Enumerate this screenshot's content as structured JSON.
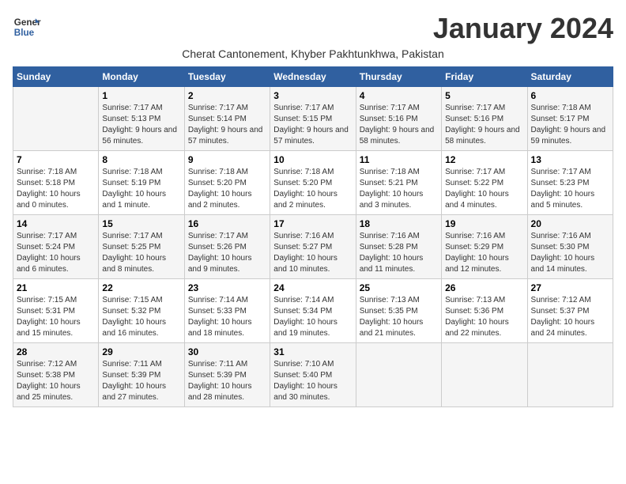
{
  "header": {
    "logo_line1": "General",
    "logo_line2": "Blue",
    "title": "January 2024",
    "subtitle": "Cherat Cantonement, Khyber Pakhtunkhwa, Pakistan"
  },
  "days_of_week": [
    "Sunday",
    "Monday",
    "Tuesday",
    "Wednesday",
    "Thursday",
    "Friday",
    "Saturday"
  ],
  "weeks": [
    [
      {
        "day": "",
        "sunrise": "",
        "sunset": "",
        "daylight": ""
      },
      {
        "day": "1",
        "sunrise": "Sunrise: 7:17 AM",
        "sunset": "Sunset: 5:13 PM",
        "daylight": "Daylight: 9 hours and 56 minutes."
      },
      {
        "day": "2",
        "sunrise": "Sunrise: 7:17 AM",
        "sunset": "Sunset: 5:14 PM",
        "daylight": "Daylight: 9 hours and 57 minutes."
      },
      {
        "day": "3",
        "sunrise": "Sunrise: 7:17 AM",
        "sunset": "Sunset: 5:15 PM",
        "daylight": "Daylight: 9 hours and 57 minutes."
      },
      {
        "day": "4",
        "sunrise": "Sunrise: 7:17 AM",
        "sunset": "Sunset: 5:16 PM",
        "daylight": "Daylight: 9 hours and 58 minutes."
      },
      {
        "day": "5",
        "sunrise": "Sunrise: 7:17 AM",
        "sunset": "Sunset: 5:16 PM",
        "daylight": "Daylight: 9 hours and 58 minutes."
      },
      {
        "day": "6",
        "sunrise": "Sunrise: 7:18 AM",
        "sunset": "Sunset: 5:17 PM",
        "daylight": "Daylight: 9 hours and 59 minutes."
      }
    ],
    [
      {
        "day": "7",
        "sunrise": "Sunrise: 7:18 AM",
        "sunset": "Sunset: 5:18 PM",
        "daylight": "Daylight: 10 hours and 0 minutes."
      },
      {
        "day": "8",
        "sunrise": "Sunrise: 7:18 AM",
        "sunset": "Sunset: 5:19 PM",
        "daylight": "Daylight: 10 hours and 1 minute."
      },
      {
        "day": "9",
        "sunrise": "Sunrise: 7:18 AM",
        "sunset": "Sunset: 5:20 PM",
        "daylight": "Daylight: 10 hours and 2 minutes."
      },
      {
        "day": "10",
        "sunrise": "Sunrise: 7:18 AM",
        "sunset": "Sunset: 5:20 PM",
        "daylight": "Daylight: 10 hours and 2 minutes."
      },
      {
        "day": "11",
        "sunrise": "Sunrise: 7:18 AM",
        "sunset": "Sunset: 5:21 PM",
        "daylight": "Daylight: 10 hours and 3 minutes."
      },
      {
        "day": "12",
        "sunrise": "Sunrise: 7:17 AM",
        "sunset": "Sunset: 5:22 PM",
        "daylight": "Daylight: 10 hours and 4 minutes."
      },
      {
        "day": "13",
        "sunrise": "Sunrise: 7:17 AM",
        "sunset": "Sunset: 5:23 PM",
        "daylight": "Daylight: 10 hours and 5 minutes."
      }
    ],
    [
      {
        "day": "14",
        "sunrise": "Sunrise: 7:17 AM",
        "sunset": "Sunset: 5:24 PM",
        "daylight": "Daylight: 10 hours and 6 minutes."
      },
      {
        "day": "15",
        "sunrise": "Sunrise: 7:17 AM",
        "sunset": "Sunset: 5:25 PM",
        "daylight": "Daylight: 10 hours and 8 minutes."
      },
      {
        "day": "16",
        "sunrise": "Sunrise: 7:17 AM",
        "sunset": "Sunset: 5:26 PM",
        "daylight": "Daylight: 10 hours and 9 minutes."
      },
      {
        "day": "17",
        "sunrise": "Sunrise: 7:16 AM",
        "sunset": "Sunset: 5:27 PM",
        "daylight": "Daylight: 10 hours and 10 minutes."
      },
      {
        "day": "18",
        "sunrise": "Sunrise: 7:16 AM",
        "sunset": "Sunset: 5:28 PM",
        "daylight": "Daylight: 10 hours and 11 minutes."
      },
      {
        "day": "19",
        "sunrise": "Sunrise: 7:16 AM",
        "sunset": "Sunset: 5:29 PM",
        "daylight": "Daylight: 10 hours and 12 minutes."
      },
      {
        "day": "20",
        "sunrise": "Sunrise: 7:16 AM",
        "sunset": "Sunset: 5:30 PM",
        "daylight": "Daylight: 10 hours and 14 minutes."
      }
    ],
    [
      {
        "day": "21",
        "sunrise": "Sunrise: 7:15 AM",
        "sunset": "Sunset: 5:31 PM",
        "daylight": "Daylight: 10 hours and 15 minutes."
      },
      {
        "day": "22",
        "sunrise": "Sunrise: 7:15 AM",
        "sunset": "Sunset: 5:32 PM",
        "daylight": "Daylight: 10 hours and 16 minutes."
      },
      {
        "day": "23",
        "sunrise": "Sunrise: 7:14 AM",
        "sunset": "Sunset: 5:33 PM",
        "daylight": "Daylight: 10 hours and 18 minutes."
      },
      {
        "day": "24",
        "sunrise": "Sunrise: 7:14 AM",
        "sunset": "Sunset: 5:34 PM",
        "daylight": "Daylight: 10 hours and 19 minutes."
      },
      {
        "day": "25",
        "sunrise": "Sunrise: 7:13 AM",
        "sunset": "Sunset: 5:35 PM",
        "daylight": "Daylight: 10 hours and 21 minutes."
      },
      {
        "day": "26",
        "sunrise": "Sunrise: 7:13 AM",
        "sunset": "Sunset: 5:36 PM",
        "daylight": "Daylight: 10 hours and 22 minutes."
      },
      {
        "day": "27",
        "sunrise": "Sunrise: 7:12 AM",
        "sunset": "Sunset: 5:37 PM",
        "daylight": "Daylight: 10 hours and 24 minutes."
      }
    ],
    [
      {
        "day": "28",
        "sunrise": "Sunrise: 7:12 AM",
        "sunset": "Sunset: 5:38 PM",
        "daylight": "Daylight: 10 hours and 25 minutes."
      },
      {
        "day": "29",
        "sunrise": "Sunrise: 7:11 AM",
        "sunset": "Sunset: 5:39 PM",
        "daylight": "Daylight: 10 hours and 27 minutes."
      },
      {
        "day": "30",
        "sunrise": "Sunrise: 7:11 AM",
        "sunset": "Sunset: 5:39 PM",
        "daylight": "Daylight: 10 hours and 28 minutes."
      },
      {
        "day": "31",
        "sunrise": "Sunrise: 7:10 AM",
        "sunset": "Sunset: 5:40 PM",
        "daylight": "Daylight: 10 hours and 30 minutes."
      },
      {
        "day": "",
        "sunrise": "",
        "sunset": "",
        "daylight": ""
      },
      {
        "day": "",
        "sunrise": "",
        "sunset": "",
        "daylight": ""
      },
      {
        "day": "",
        "sunrise": "",
        "sunset": "",
        "daylight": ""
      }
    ]
  ]
}
